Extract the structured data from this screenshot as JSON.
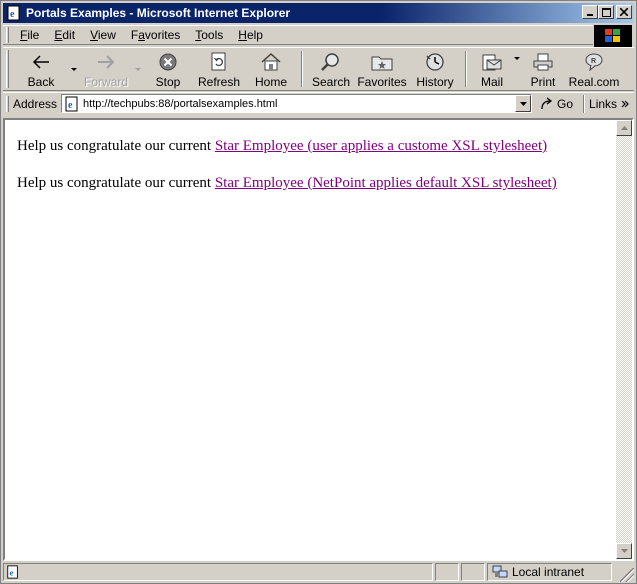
{
  "window": {
    "title": "Portals Examples - Microsoft Internet Explorer"
  },
  "menu": {
    "items": [
      {
        "key": "F",
        "rest": "ile"
      },
      {
        "key": "E",
        "rest": "dit"
      },
      {
        "key": "V",
        "rest": "iew"
      },
      {
        "key": "a",
        "pre": "F",
        "rest": "vorites"
      },
      {
        "key": "T",
        "rest": "ools"
      },
      {
        "key": "H",
        "rest": "elp"
      }
    ]
  },
  "toolbar": {
    "back": "Back",
    "forward": "Forward",
    "stop": "Stop",
    "refresh": "Refresh",
    "home": "Home",
    "search": "Search",
    "favorites": "Favorites",
    "history": "History",
    "mail": "Mail",
    "print": "Print",
    "real": "Real.com"
  },
  "address": {
    "label": "Address",
    "url": "http://techpubs:88/portalsexamples.html",
    "go": "Go",
    "links": "Links"
  },
  "page": {
    "lines": [
      {
        "text": "Help us congratulate our current ",
        "link": "Star Employee (user applies a custome XSL stylesheet)"
      },
      {
        "text": "Help us congratulate our current ",
        "link": "Star Employee (NetPoint applies default XSL stylesheet)"
      }
    ]
  },
  "status": {
    "zone": "Local intranet"
  },
  "colors": {
    "visited_link": "#800080",
    "titlebar": "#0a246a",
    "chrome": "#d4d0c8"
  }
}
